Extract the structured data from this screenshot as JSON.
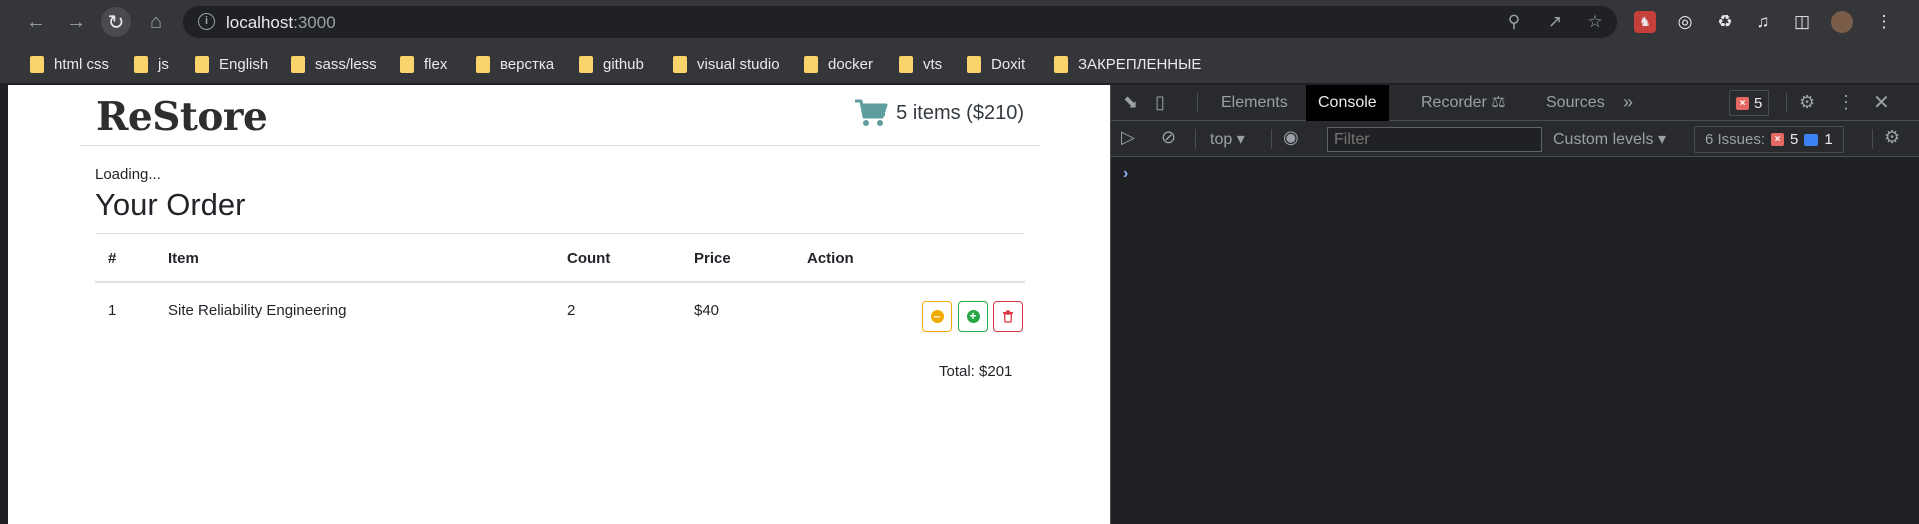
{
  "browser": {
    "url_host": "localhost",
    "url_port": ":3000",
    "bookmarks": [
      "html css",
      "js",
      "English",
      "sass/less",
      "flex",
      "верстка",
      "github",
      "visual studio",
      "docker",
      "vts",
      "Doxit",
      "ЗАКРЕПЛЕННЫЕ"
    ]
  },
  "app": {
    "logo": "ReStore",
    "cart_summary": "5 items ($210)",
    "loading": "Loading...",
    "order_title": "Your Order",
    "table": {
      "headers": [
        "#",
        "Item",
        "Count",
        "Price",
        "Action"
      ],
      "rows": [
        {
          "num": "1",
          "item": "Site Reliability Engineering",
          "count": "2",
          "price": "$40"
        }
      ]
    },
    "total": "Total: $201"
  },
  "devtools": {
    "tabs": [
      "Elements",
      "Console",
      "Recorder",
      "Sources"
    ],
    "error_count": "5",
    "context": "top",
    "filter_placeholder": "Filter",
    "levels": "Custom levels",
    "issues_label": "6 Issues:",
    "issues_errors": "5",
    "issues_info": "1",
    "prompt": "›"
  },
  "colors": {
    "accent_teal": "#5f9ea0",
    "warning": "#f0ad00",
    "success": "#28a745",
    "danger": "#dc3545"
  }
}
